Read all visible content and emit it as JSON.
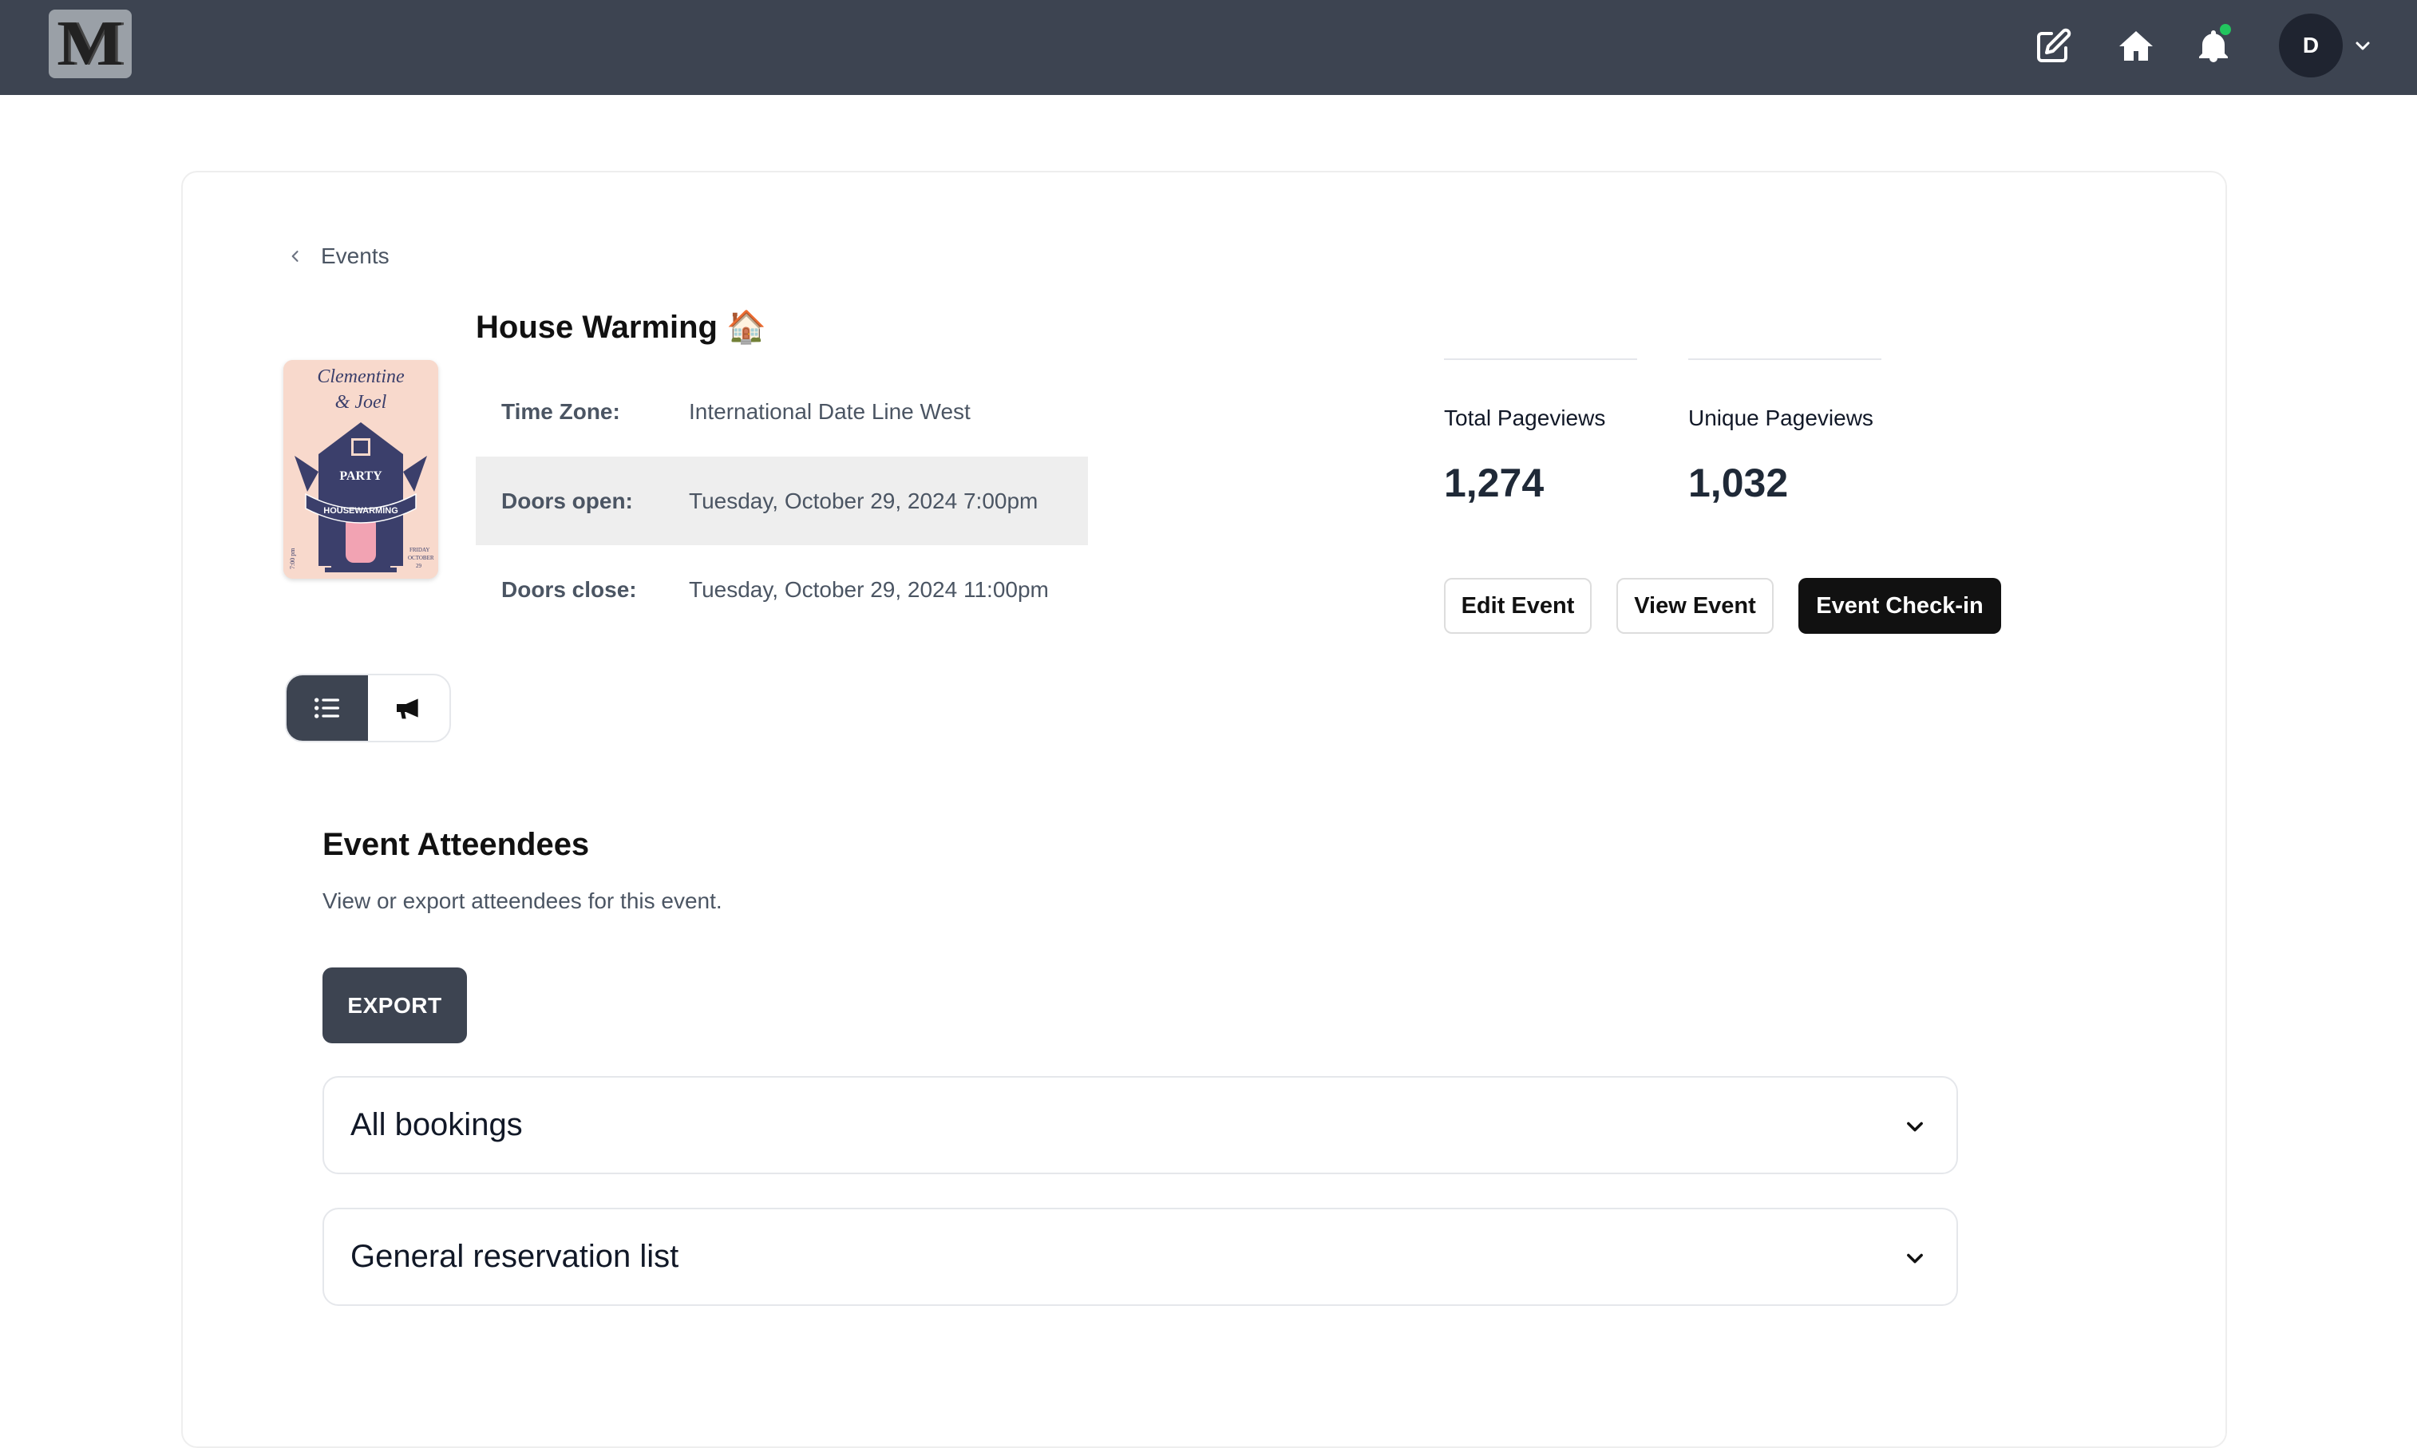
{
  "header": {
    "logo_letter": "M",
    "icons": [
      "edit-icon",
      "home-icon",
      "bell-icon"
    ],
    "notification_dot_color": "#22c55e",
    "avatar_initial": "D"
  },
  "breadcrumb": {
    "label": "Events"
  },
  "event": {
    "title": "House Warming 🏠",
    "thumbnail": {
      "line1": "Clementine",
      "line2": "& Joel",
      "house_text": "PARTY",
      "banner_text": "HOUSEWARMING",
      "time_text": "7:00 pm",
      "date_text_1": "FRIDAY",
      "date_text_2": "OCTOBER",
      "date_text_3": "29"
    },
    "details": [
      {
        "label": "Time Zone:",
        "value": "International Date Line West"
      },
      {
        "label": "Doors open:",
        "value": "Tuesday, October 29, 2024 7:00pm"
      },
      {
        "label": "Doors close:",
        "value": "Tuesday, October 29, 2024 11:00pm"
      }
    ]
  },
  "stats": [
    {
      "label": "Total Pageviews",
      "value": "1,274"
    },
    {
      "label": "Unique Pageviews",
      "value": "1,032"
    }
  ],
  "actions": {
    "edit_label": "Edit Event",
    "view_label": "View Event",
    "checkin_label": "Event Check-in"
  },
  "view_toggle": {
    "options": [
      "list-icon",
      "megaphone-icon"
    ],
    "active": "list-icon"
  },
  "attendees": {
    "title": "Event Atteendees",
    "subtitle": "View or export atteendees for this event.",
    "export_label": "EXPORT",
    "lists": [
      {
        "label": "All bookings"
      },
      {
        "label": "General reservation list"
      }
    ]
  },
  "colors": {
    "header_bg": "#3d4451",
    "primary_dark": "#111111",
    "export_bg": "#3d4451",
    "row_highlight": "#eeeeee"
  }
}
